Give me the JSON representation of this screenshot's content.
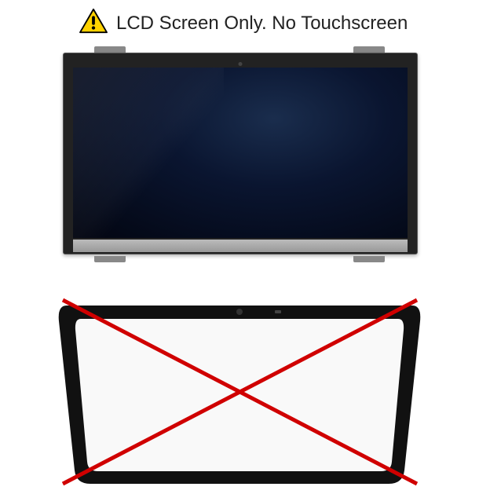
{
  "header": {
    "warning_icon": "warning-triangle",
    "text": "LCD Screen Only. No Touchscreen"
  }
}
